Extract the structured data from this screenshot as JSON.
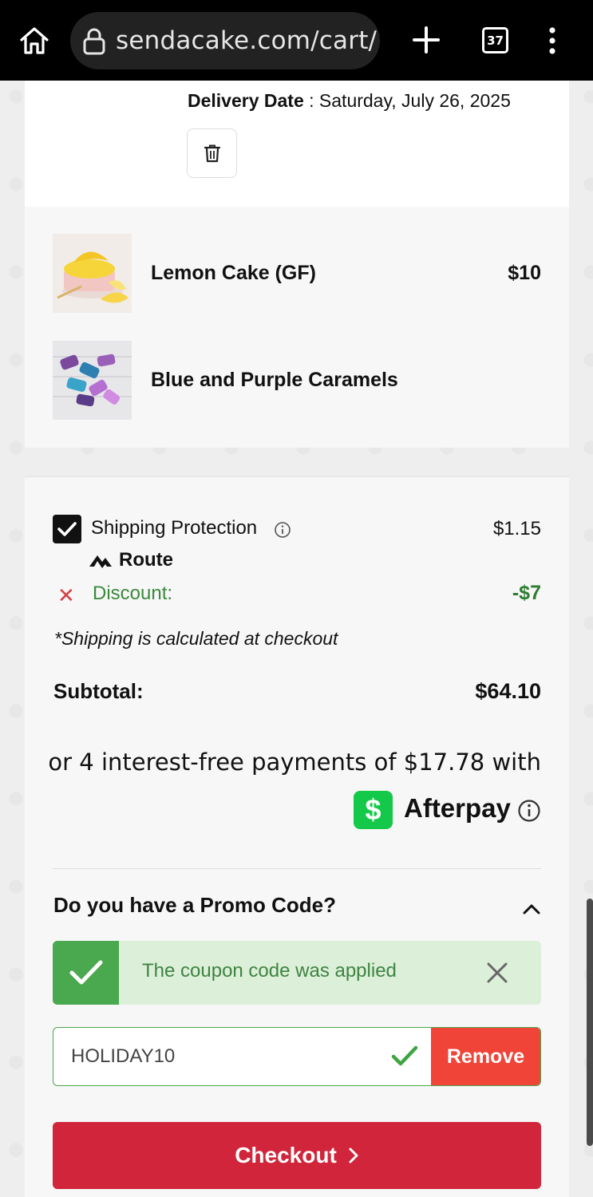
{
  "browser": {
    "url": "sendacake.com/cart/",
    "tab_count": "37"
  },
  "order": {
    "delivery_label": "Delivery Date",
    "delivery_value": "Saturday, July 26, 2025"
  },
  "items": [
    {
      "name": "Lemon Cake (GF)",
      "price": "$10"
    },
    {
      "name": "Blue and Purple Caramels",
      "price": ""
    }
  ],
  "summary": {
    "shipping_protection_label": "Shipping Protection",
    "shipping_protection_price": "$1.15",
    "route_label": "Route",
    "discount_label": "Discount:",
    "discount_value": "-$7",
    "shipping_note": "*Shipping is calculated at checkout",
    "subtotal_label": "Subtotal:",
    "subtotal_value": "$64.10",
    "afterpay_text": "or 4 interest-free payments of $17.78 with",
    "afterpay_brand": "Afterpay",
    "afterpay_icon_glyph": "$"
  },
  "promo": {
    "title": "Do you have a Promo Code?",
    "success_message": "The coupon code was applied",
    "code_value": "HOLIDAY10",
    "remove_label": "Remove"
  },
  "checkout": {
    "label": "Checkout"
  },
  "colors": {
    "checkout_red": "#d0253a",
    "remove_red": "#f04438",
    "success_green": "#4aa84e",
    "afterpay_green": "#14c94a",
    "discount_green": "#2e7d32"
  }
}
